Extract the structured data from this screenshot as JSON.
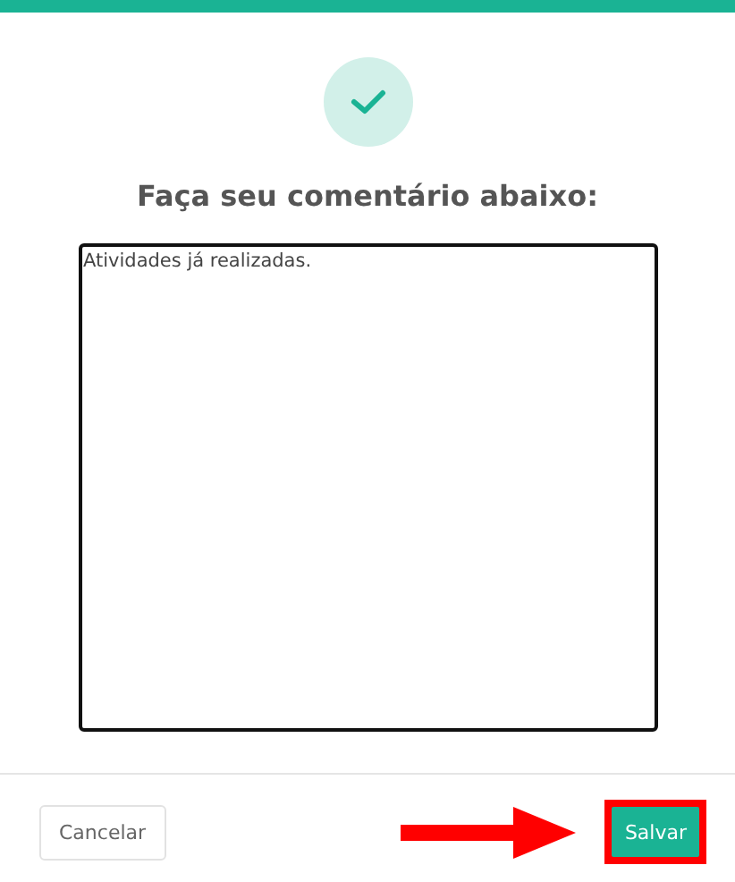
{
  "dialog": {
    "title": "Faça seu comentário abaixo:",
    "comment": {
      "value": "Atividades já realizadas."
    }
  },
  "footer": {
    "cancel_button": "Cancelar",
    "save_button": "Salvar",
    "save_highlighted": true
  }
}
